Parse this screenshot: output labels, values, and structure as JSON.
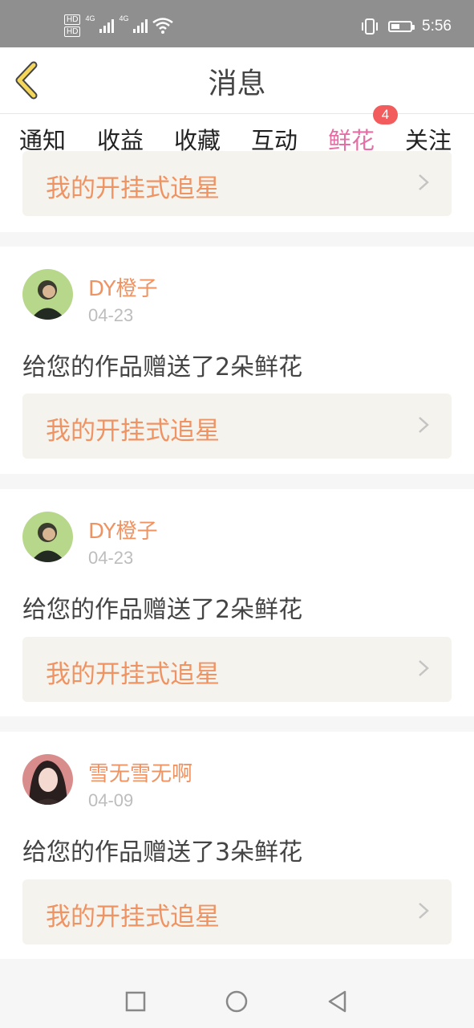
{
  "status_bar": {
    "hd_label": "HD",
    "network_label": "4G",
    "time": "5:56"
  },
  "header": {
    "title": "消息",
    "back_icon": "chevron-left-icon"
  },
  "tabs": [
    {
      "label": "通知",
      "active": false
    },
    {
      "label": "收益",
      "active": false
    },
    {
      "label": "收藏",
      "active": false
    },
    {
      "label": "互动",
      "active": false
    },
    {
      "label": "鲜花",
      "active": true,
      "badge": "4"
    },
    {
      "label": "关注",
      "active": false
    }
  ],
  "partial_card": {
    "work_title": "我的开挂式追星"
  },
  "messages": [
    {
      "user": "DY橙子",
      "date": "04-23",
      "text": "给您的作品赠送了2朵鲜花",
      "work_title": "我的开挂式追星"
    },
    {
      "user": "DY橙子",
      "date": "04-23",
      "text": "给您的作品赠送了2朵鲜花",
      "work_title": "我的开挂式追星"
    },
    {
      "user": "雪无雪无啊",
      "date": "04-09",
      "text": "给您的作品赠送了3朵鲜花",
      "work_title": "我的开挂式追星"
    }
  ],
  "colors": {
    "accent_pink": "#e56fa5",
    "orange_text": "#ef9363",
    "badge_red": "#f25c5c",
    "work_box_bg": "#f4f3ee"
  },
  "nav_bar": {
    "buttons": [
      "square-icon",
      "circle-icon",
      "back-triangle-icon"
    ]
  }
}
